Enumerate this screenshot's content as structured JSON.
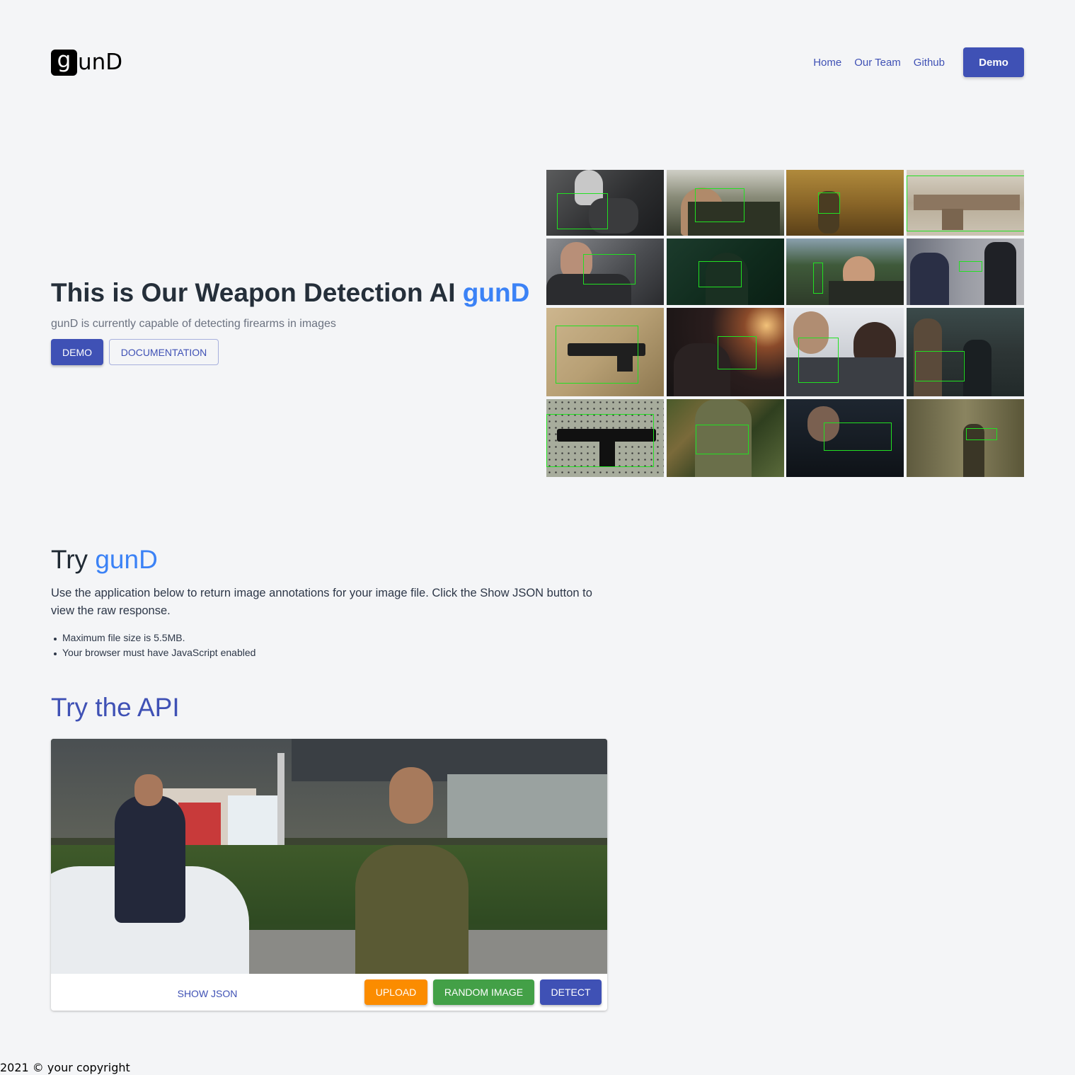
{
  "header": {
    "logo_mark": "g",
    "logo_rest": "unD",
    "nav": [
      {
        "label": "Home"
      },
      {
        "label": "Our Team"
      },
      {
        "label": "Github"
      }
    ],
    "demo_button": "Demo"
  },
  "hero": {
    "title_prefix": "This is Our Weapon Detection AI ",
    "title_accent": "gunD",
    "subtitle": "gunD is currently capable of detecting firearms in images",
    "demo_button": "DEMO",
    "docs_button": "DOCUMENTATION"
  },
  "try": {
    "title_prefix": "Try ",
    "title_accent": "gunD",
    "description": "Use the application below to return image annotations for your image file. Click the Show JSON button to view the raw response.",
    "requirements": [
      "Maximum file size is 5.5MB.",
      "Your browser must have JavaScript enabled"
    ]
  },
  "api": {
    "title": "Try the API",
    "buttons": {
      "show_json": "SHOW JSON",
      "upload": "UPLOAD",
      "random": "RANDOM IMAGE",
      "detect": "DETECT"
    }
  },
  "colors": {
    "primary": "#3f51b5",
    "accent": "#3b82f6",
    "upload": "#fb8c00",
    "random": "#43a047",
    "detection_box": "#22e022"
  },
  "footer": {
    "text": "2021 © your copyright"
  }
}
